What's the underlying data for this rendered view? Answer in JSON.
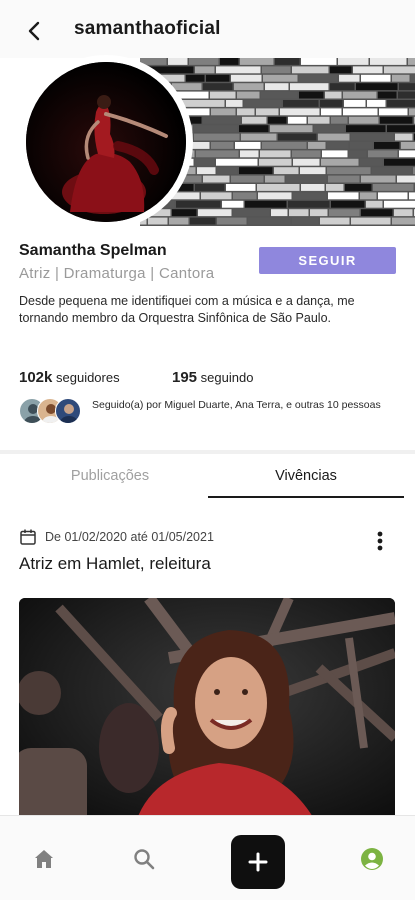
{
  "header": {
    "back_icon": "chevron-left-icon",
    "username": "samanthaoficial"
  },
  "profile": {
    "name": "Samantha Spelman",
    "roles": "Atriz | Dramaturga | Cantora",
    "follow_label": "SEGUIR",
    "bio": "Desde pequena me identifiquei com a música e a dança, me tornando membro da Orquestra Sinfônica de São Paulo.",
    "followers_count": "102k",
    "followers_label": "seguidores",
    "following_count": "195",
    "following_label": "seguindo",
    "followed_by": "Seguido(a) por Miguel Duarte, Ana Terra, e outras 10 pessoas"
  },
  "tabs": [
    {
      "label": "Publicações",
      "active": false
    },
    {
      "label": "Vivências",
      "active": true
    }
  ],
  "post": {
    "calendar_icon": "calendar-icon",
    "date_range": "De 01/02/2020 até 01/05/2021",
    "title": "Atriz em Hamlet, releitura",
    "more_icon": "more-vertical-icon"
  },
  "bottom_nav": {
    "items": [
      "home-icon",
      "search-icon",
      "plus-icon",
      "profile-icon"
    ]
  },
  "colors": {
    "accent": "#8f87dd",
    "profile_active": "#7cb342",
    "nav_add_bg": "#0f0f0f"
  }
}
